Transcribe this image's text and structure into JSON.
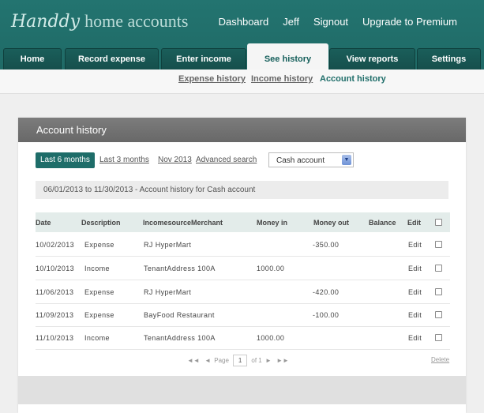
{
  "app": {
    "logo_script": "Handdy",
    "logo_rest": "home accounts"
  },
  "topnav": {
    "dashboard": "Dashboard",
    "user": "Jeff",
    "signout": "Signout",
    "upgrade": "Upgrade to Premium"
  },
  "tabs": [
    {
      "label": "Home"
    },
    {
      "label": "Record expense"
    },
    {
      "label": "Enter income"
    },
    {
      "label": "See history",
      "active": true
    },
    {
      "label": "View reports"
    },
    {
      "label": "Settings"
    }
  ],
  "subnav": [
    {
      "label": "Expense history"
    },
    {
      "label": "Income history"
    },
    {
      "label": "Account history",
      "active": true
    }
  ],
  "panel": {
    "title": "Account history",
    "filters": {
      "last6": "Last 6 months",
      "last3": "Last 3 months",
      "month": "Nov 2013",
      "advanced": "Advanced search"
    },
    "account_select": "Cash account",
    "range_text": "06/01/2013 to 11/30/2013 - Account history for Cash account"
  },
  "table": {
    "headers": {
      "date": "Date",
      "description": "Description",
      "source": "IncomesourceMerchant",
      "money_in": "Money in",
      "money_out": "Money out",
      "balance": "Balance",
      "edit": "Edit"
    },
    "rows": [
      {
        "date": "10/02/2013",
        "description": "Expense",
        "source": "RJ HyperMart",
        "money_in": "",
        "money_out": "-350.00",
        "balance": "",
        "edit": "Edit"
      },
      {
        "date": "10/10/2013",
        "description": "Income",
        "source": "TenantAddress 100A",
        "money_in": "1000.00",
        "money_out": "",
        "balance": "",
        "edit": "Edit"
      },
      {
        "date": "11/06/2013",
        "description": "Expense",
        "source": "RJ HyperMart",
        "money_in": "",
        "money_out": "-420.00",
        "balance": "",
        "edit": "Edit"
      },
      {
        "date": "11/09/2013",
        "description": "Expense",
        "source": "BayFood Restaurant",
        "money_in": "",
        "money_out": "-100.00",
        "balance": "",
        "edit": "Edit"
      },
      {
        "date": "11/10/2013",
        "description": "Income",
        "source": "TenantAddress 100A",
        "money_in": "1000.00",
        "money_out": "",
        "balance": "",
        "edit": "Edit"
      }
    ]
  },
  "pager": {
    "first": "◄◄",
    "prev": "◄",
    "page_label": "Page",
    "page_value": "1",
    "of_label": "of 1",
    "next": "►",
    "last": "►►"
  },
  "delete_label": "Delete",
  "colors": {
    "header": "#237470",
    "accent": "#1e6d69",
    "panel_head": "#717171"
  }
}
